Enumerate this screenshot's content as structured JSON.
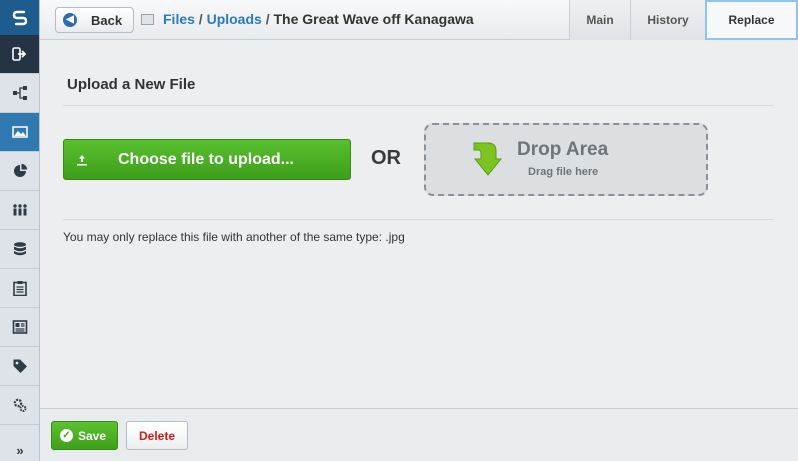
{
  "sidebar": {
    "items": [
      {
        "icon": "logo-icon"
      },
      {
        "icon": "logout-icon"
      },
      {
        "icon": "sitemap-icon"
      },
      {
        "icon": "image-icon"
      },
      {
        "icon": "pie-chart-icon"
      },
      {
        "icon": "users-icon"
      },
      {
        "icon": "database-icon"
      },
      {
        "icon": "clipboard-icon"
      },
      {
        "icon": "newspaper-icon"
      },
      {
        "icon": "tag-icon"
      },
      {
        "icon": "gears-icon"
      }
    ],
    "expand_label": "»"
  },
  "header": {
    "back_label": "Back",
    "breadcrumb": {
      "files": "Files",
      "sep1": " / ",
      "uploads": "Uploads",
      "sep2": " / ",
      "current": "The Great Wave off Kanagawa"
    },
    "tabs": [
      {
        "label": "Main"
      },
      {
        "label": "History"
      },
      {
        "label": "Replace",
        "active": true
      }
    ]
  },
  "main": {
    "heading": "Upload a New File",
    "choose_label": "Choose file to upload...",
    "or_label": "OR",
    "drop_title": "Drop Area",
    "drop_subtitle": "Drag file here",
    "note": "You may only replace this file with another of the same type: .jpg"
  },
  "footer": {
    "save_label": "Save",
    "delete_label": "Delete"
  },
  "colors": {
    "accent_blue": "#2b7bbd",
    "green": "#4caf28",
    "delete_red": "#c8201c",
    "sidebar_active": "#3079b0"
  }
}
